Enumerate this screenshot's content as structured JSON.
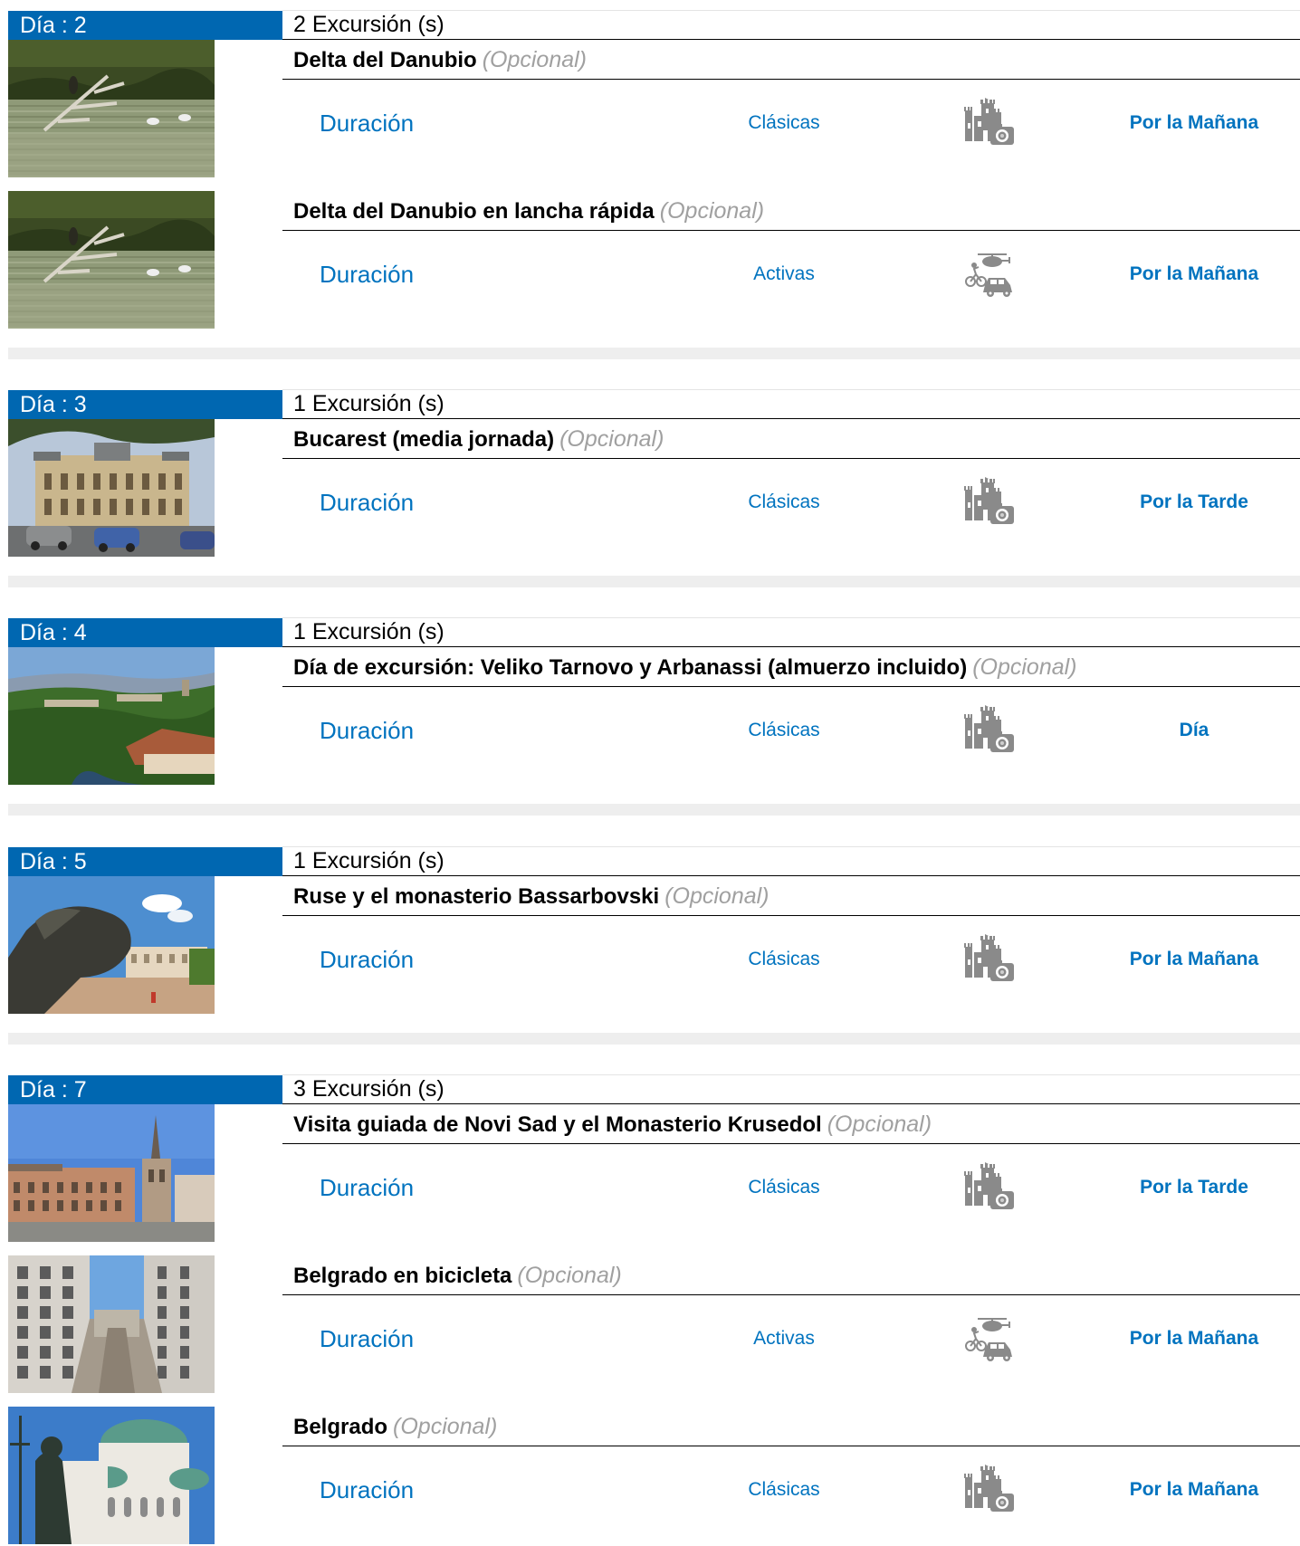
{
  "days": [
    {
      "label": "Día : 2",
      "count": "2 Excursión (s)",
      "excursions": [
        {
          "name": "Delta del Danubio",
          "optional": "(Opcional)",
          "duration_label": "Duración",
          "category": "Clásicas",
          "category_icon": "castle-camera-icon",
          "time": "Por la Mañana",
          "photo": "delta"
        },
        {
          "name": "Delta del Danubio en lancha rápida",
          "optional": "(Opcional)",
          "duration_label": "Duración",
          "category": "Activas",
          "category_icon": "adventure-vehicles-icon",
          "time": "Por la Mañana",
          "photo": "delta"
        }
      ]
    },
    {
      "label": "Día : 3",
      "count": "1 Excursión (s)",
      "excursions": [
        {
          "name": "Bucarest (media jornada)",
          "optional": "(Opcional)",
          "duration_label": "Duración",
          "category": "Clásicas",
          "category_icon": "castle-camera-icon",
          "time": "Por la Tarde",
          "photo": "bucharest"
        }
      ]
    },
    {
      "label": "Día : 4",
      "count": "1 Excursión (s)",
      "excursions": [
        {
          "name": "Día de excursión: Veliko Tarnovo y Arbanassi (almuerzo incluido)",
          "optional": "(Opcional)",
          "duration_label": "Duración",
          "category": "Clásicas",
          "category_icon": "castle-camera-icon",
          "time": "Día",
          "photo": "tarnovo"
        }
      ]
    },
    {
      "label": "Día : 5",
      "count": "1 Excursión (s)",
      "excursions": [
        {
          "name": "Ruse y el monasterio Bassarbovski",
          "optional": "(Opcional)",
          "duration_label": "Duración",
          "category": "Clásicas",
          "category_icon": "castle-camera-icon",
          "time": "Por la Mañana",
          "photo": "ruse"
        }
      ]
    },
    {
      "label": "Día : 7",
      "count": "3 Excursión (s)",
      "excursions": [
        {
          "name": "Visita guiada de Novi Sad y el Monasterio Krusedol",
          "optional": "(Opcional)",
          "duration_label": "Duración",
          "category": "Clásicas",
          "category_icon": "castle-camera-icon",
          "time": "Por la Tarde",
          "photo": "novisad"
        },
        {
          "name": "Belgrado en bicicleta",
          "optional": "(Opcional)",
          "duration_label": "Duración",
          "category": "Activas",
          "category_icon": "adventure-vehicles-icon",
          "time": "Por la Mañana",
          "photo": "belgrade-street"
        },
        {
          "name": "Belgrado",
          "optional": "(Opcional)",
          "duration_label": "Duración",
          "category": "Clásicas",
          "category_icon": "castle-camera-icon",
          "time": "Por la Mañana",
          "photo": "belgrade-church"
        }
      ]
    }
  ]
}
